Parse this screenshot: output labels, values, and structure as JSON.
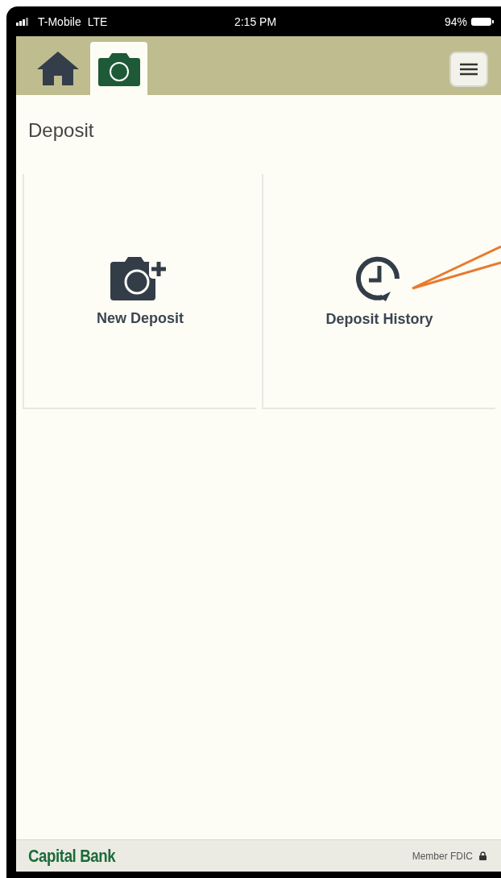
{
  "status_bar": {
    "carrier": "T-Mobile",
    "network": "LTE",
    "time": "2:15 PM",
    "battery": "94%"
  },
  "tabs": [
    {
      "kind": "home",
      "selected": false
    },
    {
      "kind": "camera",
      "selected": true
    }
  ],
  "page_title": "Deposit",
  "tiles": [
    {
      "kind": "new",
      "label": "New Deposit"
    },
    {
      "kind": "history",
      "label": "Deposit History"
    }
  ],
  "footer": {
    "brand": "Capital Bank",
    "member": "Member FDIC"
  }
}
